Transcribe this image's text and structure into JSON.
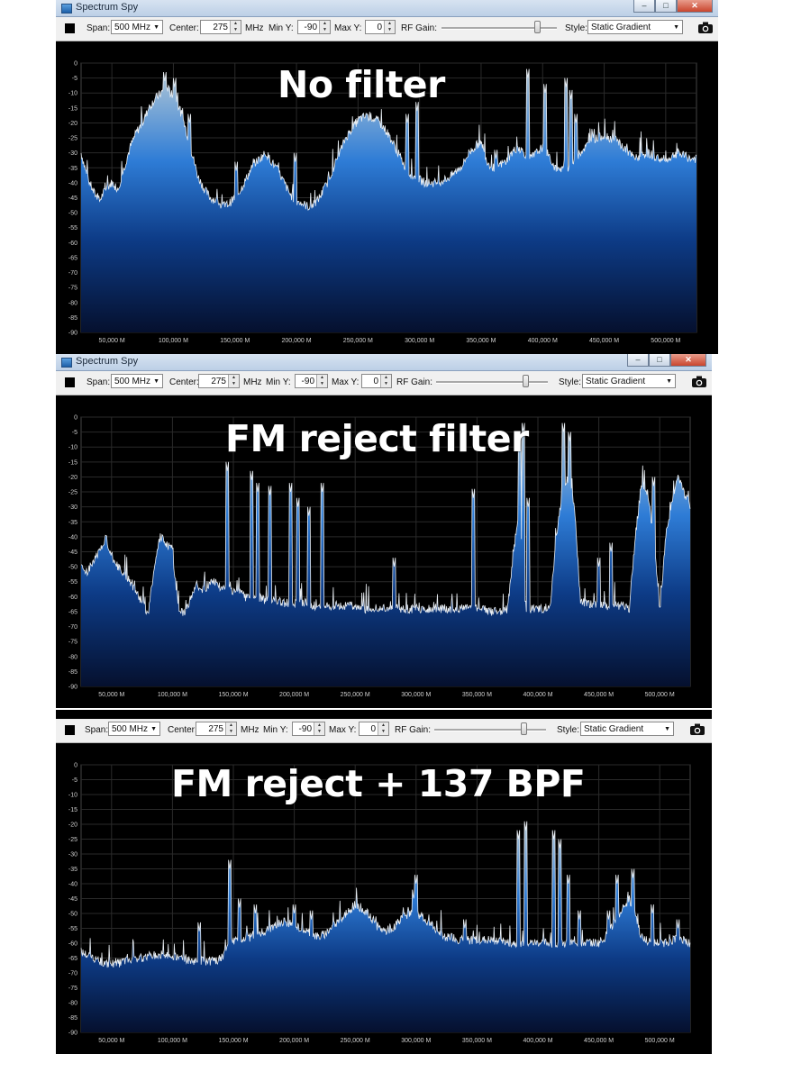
{
  "window_title": "Spectrum Spy",
  "toolbar": {
    "span_label": "Span:",
    "span_value": "500 MHz",
    "center_label": "Center:",
    "center_value": "275",
    "center_unit": "MHz",
    "miny_label": "Min Y:",
    "miny_value": "-90",
    "maxy_label": "Max Y:",
    "maxy_value": "0",
    "rfgain_label": "RF Gain:",
    "style_label": "Style:",
    "style_value": "Static Gradient"
  },
  "window_buttons": {
    "minimize": "–",
    "maximize": "□",
    "close": "✕"
  },
  "icons": {
    "color_swatch": "color-swatch-icon",
    "camera": "camera-icon"
  },
  "colors": {
    "accent": "#2e7cd6",
    "fill_top": "#8fb2cc",
    "fill_bottom": "#05102e",
    "background": "#000000"
  },
  "panels": [
    {
      "overlay_title": "No filter",
      "rf_gain_level": 0.83,
      "chart_data": {
        "type": "area",
        "ylim": [
          -90,
          0
        ],
        "yticks": [
          "0",
          "-5",
          "-10",
          "-15",
          "-20",
          "-25",
          "-30",
          "-35",
          "-40",
          "-45",
          "-50",
          "-55",
          "-60",
          "-65",
          "-70",
          "-75",
          "-80",
          "-85",
          "-90"
        ],
        "xticks": [
          "50,000 M",
          "100,000 M",
          "150,000 M",
          "200,000 M",
          "250,000 M",
          "300,000 M",
          "350,000 M",
          "400,000 M",
          "450,000 M",
          "500,000 M"
        ],
        "xlim": [
          25,
          525
        ],
        "x": [
          25,
          30,
          35,
          40,
          45,
          50,
          55,
          60,
          65,
          70,
          75,
          80,
          85,
          90,
          95,
          100,
          105,
          110,
          115,
          120,
          125,
          130,
          135,
          140,
          145,
          150,
          155,
          160,
          165,
          170,
          175,
          180,
          185,
          190,
          195,
          200,
          205,
          210,
          215,
          220,
          225,
          230,
          235,
          240,
          245,
          250,
          255,
          260,
          265,
          270,
          275,
          280,
          285,
          290,
          295,
          300,
          305,
          310,
          315,
          320,
          325,
          330,
          335,
          340,
          345,
          350,
          355,
          360,
          365,
          370,
          375,
          380,
          385,
          390,
          395,
          400,
          405,
          410,
          415,
          420,
          425,
          430,
          435,
          440,
          445,
          450,
          455,
          460,
          465,
          470,
          475,
          480,
          485,
          490,
          495,
          500,
          505,
          510,
          515,
          520,
          525
        ],
        "values": [
          -30,
          -38,
          -43,
          -46,
          -42,
          -40,
          -42,
          -35,
          -28,
          -23,
          -20,
          -15,
          -12,
          -10,
          -8,
          -12,
          -15,
          -22,
          -30,
          -38,
          -42,
          -45,
          -46,
          -48,
          -47,
          -45,
          -42,
          -38,
          -34,
          -32,
          -30,
          -33,
          -36,
          -40,
          -44,
          -46,
          -47,
          -48,
          -47,
          -44,
          -40,
          -35,
          -30,
          -25,
          -22,
          -19,
          -18,
          -18,
          -19,
          -21,
          -24,
          -28,
          -32,
          -36,
          -38,
          -39,
          -40,
          -40,
          -40,
          -39,
          -38,
          -36,
          -34,
          -30,
          -28,
          -26,
          -33,
          -35,
          -34,
          -33,
          -30,
          -28,
          -30,
          -32,
          -30,
          -28,
          -31,
          -35,
          -36,
          -35,
          -33,
          -30,
          -28,
          -26,
          -25,
          -24,
          -25,
          -26,
          -28,
          -30,
          -32,
          -31,
          -30,
          -31,
          -32,
          -33,
          -31,
          -30,
          -31,
          -32,
          -32
        ],
        "spikes": [
          [
            93,
            -6
          ],
          [
            101,
            -8
          ],
          [
            113,
            -20
          ],
          [
            151,
            -36
          ],
          [
            167,
            -36
          ],
          [
            199,
            -33
          ],
          [
            242,
            -42
          ],
          [
            290,
            -20
          ],
          [
            298,
            -16
          ],
          [
            362,
            -32
          ],
          [
            388,
            -5
          ],
          [
            402,
            -10
          ],
          [
            419,
            -8
          ],
          [
            423,
            -12
          ],
          [
            427,
            -20
          ],
          [
            441,
            -25
          ],
          [
            459,
            -36
          ],
          [
            474,
            -36
          ]
        ]
      }
    },
    {
      "overlay_title": "FM reject filter",
      "rf_gain_level": 0.8,
      "chart_data": {
        "type": "area",
        "ylim": [
          -90,
          0
        ],
        "yticks": [
          "0",
          "-5",
          "-10",
          "-15",
          "-20",
          "-25",
          "-30",
          "-35",
          "-40",
          "-45",
          "-50",
          "-55",
          "-60",
          "-65",
          "-70",
          "-75",
          "-80",
          "-85",
          "-90"
        ],
        "xticks": [
          "50,000 M",
          "100,000 M",
          "150,000 M",
          "200,000 M",
          "250,000 M",
          "300,000 M",
          "350,000 M",
          "400,000 M",
          "450,000 M",
          "500,000 M"
        ],
        "xlim": [
          25,
          525
        ],
        "x": [
          25,
          30,
          35,
          40,
          45,
          50,
          55,
          60,
          65,
          70,
          75,
          80,
          85,
          90,
          95,
          100,
          105,
          110,
          115,
          120,
          125,
          130,
          135,
          140,
          145,
          150,
          155,
          160,
          165,
          170,
          175,
          180,
          185,
          190,
          195,
          200,
          205,
          210,
          215,
          220,
          225,
          230,
          235,
          240,
          245,
          250,
          255,
          260,
          265,
          270,
          275,
          280,
          285,
          290,
          295,
          300,
          305,
          310,
          315,
          320,
          325,
          330,
          335,
          340,
          345,
          350,
          355,
          360,
          365,
          370,
          375,
          380,
          385,
          390,
          395,
          400,
          405,
          410,
          415,
          420,
          425,
          430,
          435,
          440,
          445,
          450,
          455,
          460,
          465,
          470,
          475,
          480,
          485,
          490,
          495,
          500,
          505,
          510,
          515,
          520,
          525
        ],
        "values": [
          -50,
          -52,
          -48,
          -45,
          -40,
          -46,
          -50,
          -52,
          -55,
          -58,
          -62,
          -66,
          -50,
          -40,
          -42,
          -45,
          -64,
          -66,
          -60,
          -56,
          -58,
          -56,
          -55,
          -57,
          -57,
          -58,
          -58,
          -60,
          -60,
          -60,
          -61,
          -61,
          -61,
          -62,
          -62,
          -62,
          -62,
          -62,
          -63,
          -63,
          -63,
          -63,
          -63,
          -63,
          -63,
          -63,
          -64,
          -64,
          -64,
          -64,
          -64,
          -64,
          -64,
          -64,
          -64,
          -64,
          -64,
          -64,
          -64,
          -64,
          -64,
          -64,
          -64,
          -64,
          -64,
          -64,
          -64,
          -65,
          -65,
          -65,
          -64,
          -45,
          -30,
          -64,
          -64,
          -64,
          -64,
          -63,
          -40,
          -25,
          -20,
          -30,
          -62,
          -62,
          -63,
          -63,
          -63,
          -63,
          -63,
          -63,
          -64,
          -40,
          -22,
          -25,
          -40,
          -65,
          -40,
          -28,
          -20,
          -25,
          -30
        ],
        "spikes": [
          [
            145,
            -18
          ],
          [
            165,
            -21
          ],
          [
            170,
            -25
          ],
          [
            180,
            -26
          ],
          [
            197,
            -25
          ],
          [
            203,
            -30
          ],
          [
            212,
            -33
          ],
          [
            223,
            -25
          ],
          [
            282,
            -50
          ],
          [
            347,
            -27
          ],
          [
            385,
            -10
          ],
          [
            388,
            -5
          ],
          [
            392,
            -30
          ],
          [
            421,
            -5
          ],
          [
            426,
            -8
          ],
          [
            450,
            -50
          ],
          [
            460,
            -45
          ],
          [
            495,
            -23
          ]
        ]
      }
    },
    {
      "overlay_title": "FM reject + 137 BPF",
      "rf_gain_level": 0.8,
      "chart_data": {
        "type": "area",
        "ylim": [
          -90,
          0
        ],
        "yticks": [
          "0",
          "-5",
          "-10",
          "-15",
          "-20",
          "-25",
          "-30",
          "-35",
          "-40",
          "-45",
          "-50",
          "-55",
          "-60",
          "-65",
          "-70",
          "-75",
          "-80",
          "-85",
          "-90"
        ],
        "xticks": [
          "50,000 M",
          "100,000 M",
          "150,000 M",
          "200,000 M",
          "250,000 M",
          "300,000 M",
          "350,000 M",
          "400,000 M",
          "450,000 M",
          "500,000 M"
        ],
        "xlim": [
          25,
          525
        ],
        "x": [
          25,
          30,
          35,
          40,
          45,
          50,
          55,
          60,
          65,
          70,
          75,
          80,
          85,
          90,
          95,
          100,
          105,
          110,
          115,
          120,
          125,
          130,
          135,
          140,
          145,
          150,
          155,
          160,
          165,
          170,
          175,
          180,
          185,
          190,
          195,
          200,
          205,
          210,
          215,
          220,
          225,
          230,
          235,
          240,
          245,
          250,
          255,
          260,
          265,
          270,
          275,
          280,
          285,
          290,
          295,
          300,
          305,
          310,
          315,
          320,
          325,
          330,
          335,
          340,
          345,
          350,
          355,
          360,
          365,
          370,
          375,
          380,
          385,
          390,
          395,
          400,
          405,
          410,
          415,
          420,
          425,
          430,
          435,
          440,
          445,
          450,
          455,
          460,
          465,
          470,
          475,
          480,
          485,
          490,
          495,
          500,
          505,
          510,
          515,
          520,
          525
        ],
        "values": [
          -63,
          -64,
          -65,
          -66,
          -67,
          -67,
          -67,
          -66,
          -66,
          -65,
          -65,
          -64,
          -64,
          -64,
          -64,
          -64,
          -65,
          -65,
          -66,
          -66,
          -66,
          -66,
          -66,
          -65,
          -62,
          -59,
          -59,
          -58,
          -58,
          -57,
          -56,
          -55,
          -54,
          -53,
          -53,
          -54,
          -55,
          -56,
          -57,
          -58,
          -57,
          -55,
          -53,
          -51,
          -49,
          -47,
          -48,
          -50,
          -53,
          -55,
          -56,
          -55,
          -53,
          -51,
          -50,
          -50,
          -51,
          -53,
          -55,
          -57,
          -58,
          -58,
          -59,
          -59,
          -59,
          -59,
          -59,
          -59,
          -59,
          -59,
          -60,
          -60,
          -60,
          -60,
          -60,
          -60,
          -60,
          -60,
          -60,
          -60,
          -60,
          -60,
          -60,
          -60,
          -60,
          -60,
          -58,
          -55,
          -52,
          -48,
          -45,
          -50,
          -58,
          -60,
          -60,
          -60,
          -60,
          -59,
          -58,
          -59,
          -60
        ],
        "spikes": [
          [
            122,
            -56
          ],
          [
            147,
            -35
          ],
          [
            155,
            -48
          ],
          [
            168,
            -50
          ],
          [
            200,
            -50
          ],
          [
            214,
            -52
          ],
          [
            266,
            -54
          ],
          [
            298,
            -45
          ],
          [
            300,
            -40
          ],
          [
            340,
            -55
          ],
          [
            384,
            -25
          ],
          [
            390,
            -22
          ],
          [
            413,
            -25
          ],
          [
            418,
            -28
          ],
          [
            425,
            -40
          ],
          [
            434,
            -52
          ],
          [
            458,
            -52
          ],
          [
            465,
            -40
          ],
          [
            478,
            -38
          ],
          [
            494,
            -50
          ],
          [
            515,
            -55
          ]
        ]
      }
    }
  ]
}
